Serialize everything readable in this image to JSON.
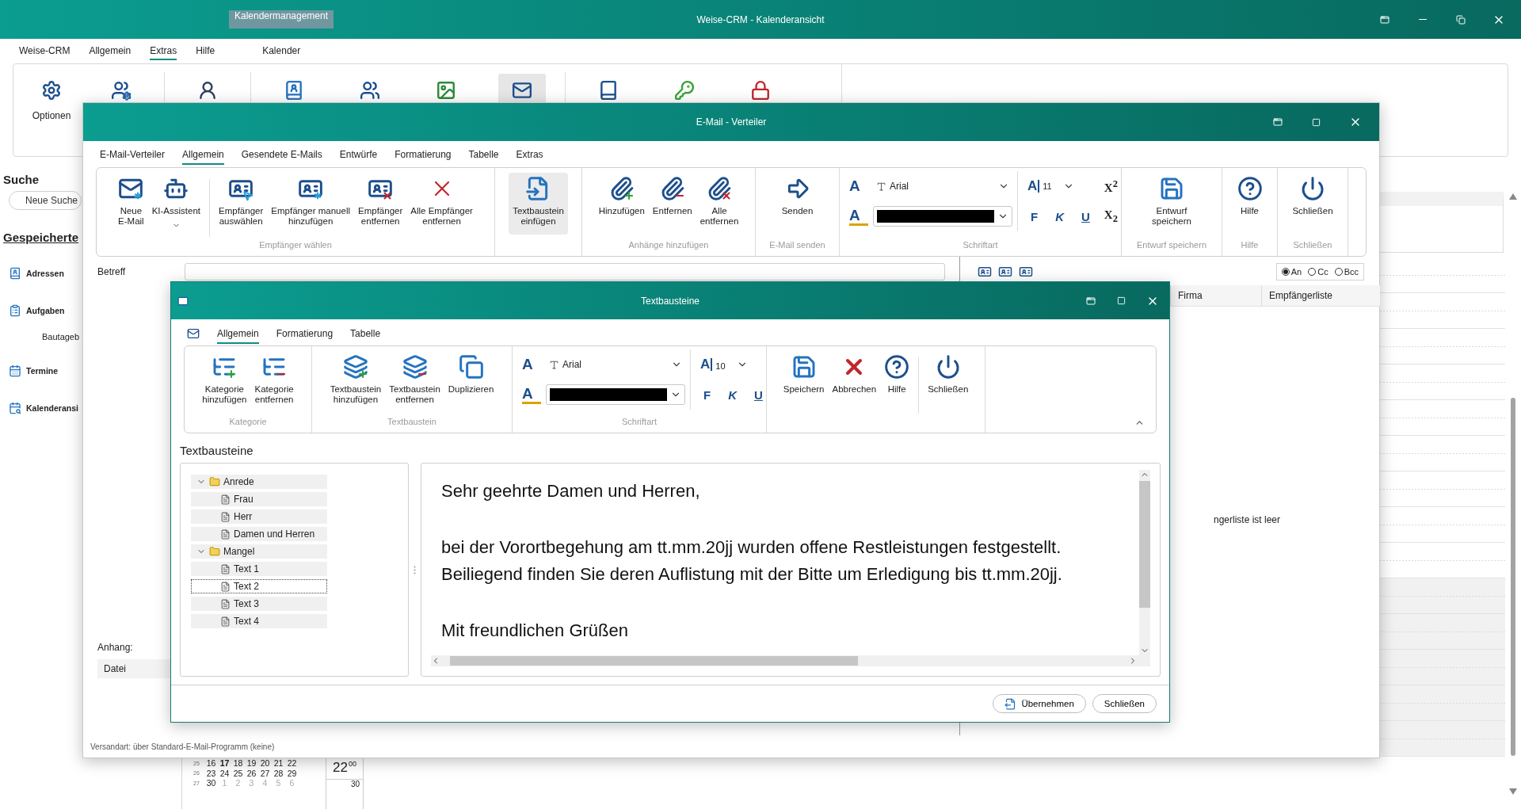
{
  "main_window": {
    "title": "Weise-CRM - Kalenderansicht",
    "context_tab": "Kalendermanagement",
    "menu": [
      {
        "label": "Weise-CRM",
        "selected": false
      },
      {
        "label": "Allgemein",
        "selected": false
      },
      {
        "label": "Extras",
        "selected": true
      },
      {
        "label": "Hilfe",
        "selected": false
      },
      {
        "label": "Kalender",
        "selected": false
      }
    ],
    "ribbon": [
      {
        "label": "Optionen",
        "highlighted": false
      },
      {
        "highlighted": false
      },
      {
        "highlighted": false
      },
      {
        "highlighted": false
      },
      {
        "highlighted": false
      },
      {
        "highlighted": false
      },
      {
        "highlighted": true
      },
      {
        "highlighted": false
      },
      {
        "highlighted": false
      },
      {
        "highlighted": false
      }
    ],
    "sidebar": {
      "search_title": "Suche",
      "search_button": "Neue Suche",
      "saved_title": "Gespeicherte",
      "items": [
        {
          "label": "Adressen"
        },
        {
          "label": "Aufgaben",
          "children": [
            {
              "label": "Bautageb"
            }
          ]
        },
        {
          "label": "Termine"
        },
        {
          "label": "Kalenderansi"
        }
      ]
    },
    "mini_calendar": {
      "weeks": [
        {
          "week": "25",
          "days": [
            {
              "label": "16",
              "today": false,
              "other_month": false
            },
            {
              "label": "17",
              "today": true,
              "other_month": false
            },
            {
              "label": "18",
              "today": false,
              "other_month": false
            },
            {
              "label": "19",
              "today": false,
              "other_month": false
            },
            {
              "label": "20",
              "today": false,
              "other_month": false
            },
            {
              "label": "21",
              "today": false,
              "other_month": false
            },
            {
              "label": "22",
              "today": false,
              "other_month": false
            }
          ]
        },
        {
          "week": "26",
          "days": [
            {
              "label": "23",
              "today": false,
              "other_month": false
            },
            {
              "label": "24",
              "today": false,
              "other_month": false
            },
            {
              "label": "25",
              "today": false,
              "other_month": false
            },
            {
              "label": "26",
              "today": false,
              "other_month": false
            },
            {
              "label": "27",
              "today": false,
              "other_month": false
            },
            {
              "label": "28",
              "today": false,
              "other_month": false
            },
            {
              "label": "29",
              "today": false,
              "other_month": false
            }
          ]
        },
        {
          "week": "27",
          "days": [
            {
              "label": "30",
              "today": false,
              "other_month": false
            },
            {
              "label": "1",
              "today": false,
              "other_month": true
            },
            {
              "label": "2",
              "today": false,
              "other_month": true
            },
            {
              "label": "3",
              "today": false,
              "other_month": true
            },
            {
              "label": "4",
              "today": false,
              "other_month": true
            },
            {
              "label": "5",
              "today": false,
              "other_month": true
            },
            {
              "label": "6",
              "today": false,
              "other_month": true
            }
          ]
        }
      ]
    },
    "time_grid": {
      "hour": "22",
      "minute": "00",
      "half_hour": "30"
    }
  },
  "email_window": {
    "title": "E-Mail - Verteiler",
    "tabs": [
      {
        "label": "E-Mail-Verteiler",
        "selected": false
      },
      {
        "label": "Allgemein",
        "selected": true
      },
      {
        "label": "Gesendete E-Mails",
        "selected": false
      },
      {
        "label": "Entwürfe",
        "selected": false
      },
      {
        "label": "Formatierung",
        "selected": false
      },
      {
        "label": "Tabelle",
        "selected": false
      },
      {
        "label": "Extras",
        "selected": false
      }
    ],
    "ribbon_groups": [
      {
        "kind": "buttons",
        "label": "Empfänger wählen",
        "buttons": [
          {
            "label": [
              "Neue",
              "E-Mail"
            ],
            "dropdown": false,
            "highlighted": false
          },
          {
            "label": [
              "KI-Assistent"
            ],
            "dropdown": true,
            "highlighted": false
          },
          {
            "label": [
              "Empfänger",
              "auswählen"
            ],
            "dropdown": false,
            "highlighted": false
          },
          {
            "label": [
              "Empfänger manuell",
              "hinzufügen"
            ],
            "dropdown": false,
            "highlighted": false
          },
          {
            "label": [
              "Empfänger",
              "entfernen"
            ],
            "dropdown": false,
            "highlighted": false
          },
          {
            "label": [
              "Alle Empfänger",
              "entfernen"
            ],
            "dropdown": false,
            "highlighted": false
          }
        ]
      },
      {
        "kind": "buttons",
        "buttons": [
          {
            "label": [
              "Textbaustein",
              "einfügen"
            ],
            "dropdown": false,
            "highlighted": true
          }
        ]
      },
      {
        "kind": "buttons",
        "label": "Anhänge hinzufügen",
        "buttons": [
          {
            "label": [
              "Hinzufügen"
            ],
            "dropdown": false,
            "highlighted": false
          },
          {
            "label": [
              "Entfernen"
            ],
            "dropdown": false,
            "highlighted": false
          },
          {
            "label": [
              "Alle",
              "entfernen"
            ],
            "dropdown": false,
            "highlighted": false
          }
        ]
      },
      {
        "kind": "buttons",
        "label": "E-Mail senden",
        "buttons": [
          {
            "label": [
              "Senden"
            ],
            "dropdown": false,
            "highlighted": false
          }
        ]
      },
      {
        "kind": "font",
        "label": "Schriftart",
        "font": {
          "font_glyph": "A",
          "size_glyph": "A",
          "color_glyph": "A",
          "name": "Arial",
          "size": "11",
          "color": "#000000",
          "styles": [
            "F",
            "K",
            "U"
          ],
          "scripts": [
            "X$^{2}$",
            "X$_{2}$"
          ]
        }
      },
      {
        "kind": "buttons",
        "label": "Entwurf speichern",
        "buttons": [
          {
            "label": [
              "Entwurf",
              "speichern"
            ],
            "dropdown": false,
            "highlighted": false
          }
        ]
      },
      {
        "kind": "buttons",
        "label": "Hilfe",
        "buttons": [
          {
            "label": [
              "Hilfe"
            ],
            "dropdown": false,
            "highlighted": false
          }
        ]
      },
      {
        "kind": "buttons",
        "label": "Schließen",
        "buttons": [
          {
            "label": [
              "Schließen"
            ],
            "dropdown": false,
            "highlighted": false
          }
        ]
      }
    ],
    "subject_label": "Betreff",
    "recipient_types": [
      {
        "label": "An",
        "selected": true
      },
      {
        "label": "Cc",
        "selected": false
      },
      {
        "label": "Bcc",
        "selected": false
      }
    ],
    "columns": [
      "Firma",
      "Empfängerliste"
    ],
    "empty_message": "ngerliste ist leer",
    "attachments_label": "Anhang:",
    "attachment_columns": [
      "Datei"
    ],
    "status": "Versandart: über Standard-E-Mail-Programm (keine)"
  },
  "textbausteine_window": {
    "title": "Textbausteine",
    "tabs": [
      {
        "label": "Allgemein",
        "selected": true
      },
      {
        "label": "Formatierung",
        "selected": false
      },
      {
        "label": "Tabelle",
        "selected": false
      }
    ],
    "ribbon_groups": [
      {
        "kind": "buttons",
        "label": "Kategorie",
        "buttons": [
          {
            "label": [
              "Kategorie",
              "hinzufügen"
            ]
          },
          {
            "label": [
              "Kategorie",
              "entfernen"
            ]
          }
        ]
      },
      {
        "kind": "buttons",
        "label": "Textbaustein",
        "buttons": [
          {
            "label": [
              "Textbaustein",
              "hinzufügen"
            ]
          },
          {
            "label": [
              "Textbaustein",
              "entfernen"
            ]
          },
          {
            "label": [
              "Duplizieren"
            ]
          }
        ]
      },
      {
        "kind": "font",
        "label": "Schriftart",
        "font": {
          "font_glyph": "A",
          "size_glyph": "A",
          "color_glyph": "A",
          "name": "Arial",
          "size": "10",
          "color": "#000000",
          "styles": [
            "F",
            "K",
            "U"
          ]
        }
      },
      {
        "kind": "buttons",
        "buttons": [
          {
            "label": [
              "Speichern"
            ]
          },
          {
            "label": [
              "Abbrechen"
            ]
          },
          {
            "label": [
              "Hilfe"
            ]
          },
          {
            "label": [
              "Schließen"
            ]
          }
        ]
      }
    ],
    "section_title": "Textbausteine",
    "tree": [
      {
        "label": "Anrede",
        "expanded": true,
        "selected": false,
        "children": [
          {
            "label": "Frau",
            "selected": false
          },
          {
            "label": "Herr",
            "selected": false
          },
          {
            "label": "Damen und Herren",
            "selected": false
          }
        ]
      },
      {
        "label": "Mangel",
        "expanded": true,
        "selected": false,
        "children": [
          {
            "label": "Text 1",
            "selected": false
          },
          {
            "label": "Text 2",
            "selected": true
          },
          {
            "label": "Text 3",
            "selected": false
          },
          {
            "label": "Text 4",
            "selected": false
          }
        ]
      }
    ],
    "editor": {
      "paragraphs": [
        [
          "Sehr geehrte Damen und Herren,"
        ],
        [
          "bei der Vorortbegehung am tt.mm.20jj wurden offene Restleistungen festgestellt.",
          "Beiliegend finden Sie deren Auflistung mit der Bitte um Erledigung bis tt.mm.20jj."
        ],
        [
          "Mit freundlichen Grüßen"
        ]
      ]
    },
    "buttons": [
      "Übernehmen",
      "Schließen"
    ]
  }
}
